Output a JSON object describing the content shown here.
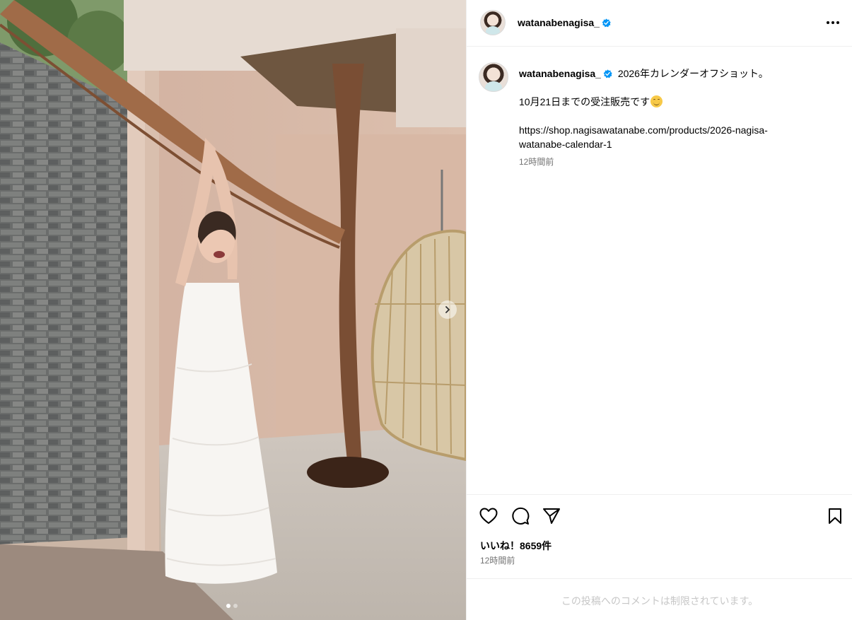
{
  "post": {
    "username": "watanabenagisa_",
    "verified": true,
    "caption_lines": [
      "2026年カレンダーオフショット。",
      "10月21日までの受注販売です",
      "https://shop.nagisawatanabe.com/products/2026-nagisa-",
      "watanabe-calendar-1"
    ],
    "caption_time": "12時間前",
    "likes_text": "いいね！8659件",
    "post_time": "12時間前",
    "comments_notice": "この投稿へのコメントは制限されています。"
  },
  "carousel": {
    "total": 2,
    "current": 1
  },
  "icons": {
    "more": "more-options-icon",
    "like": "heart-icon",
    "comment": "comment-icon",
    "share": "share-icon",
    "save": "bookmark-icon",
    "next": "chevron-right-icon",
    "emoji": "smiling-face-emoji"
  },
  "colors": {
    "verified": "#0095f6",
    "muted": "#737373",
    "border": "#efefef"
  }
}
